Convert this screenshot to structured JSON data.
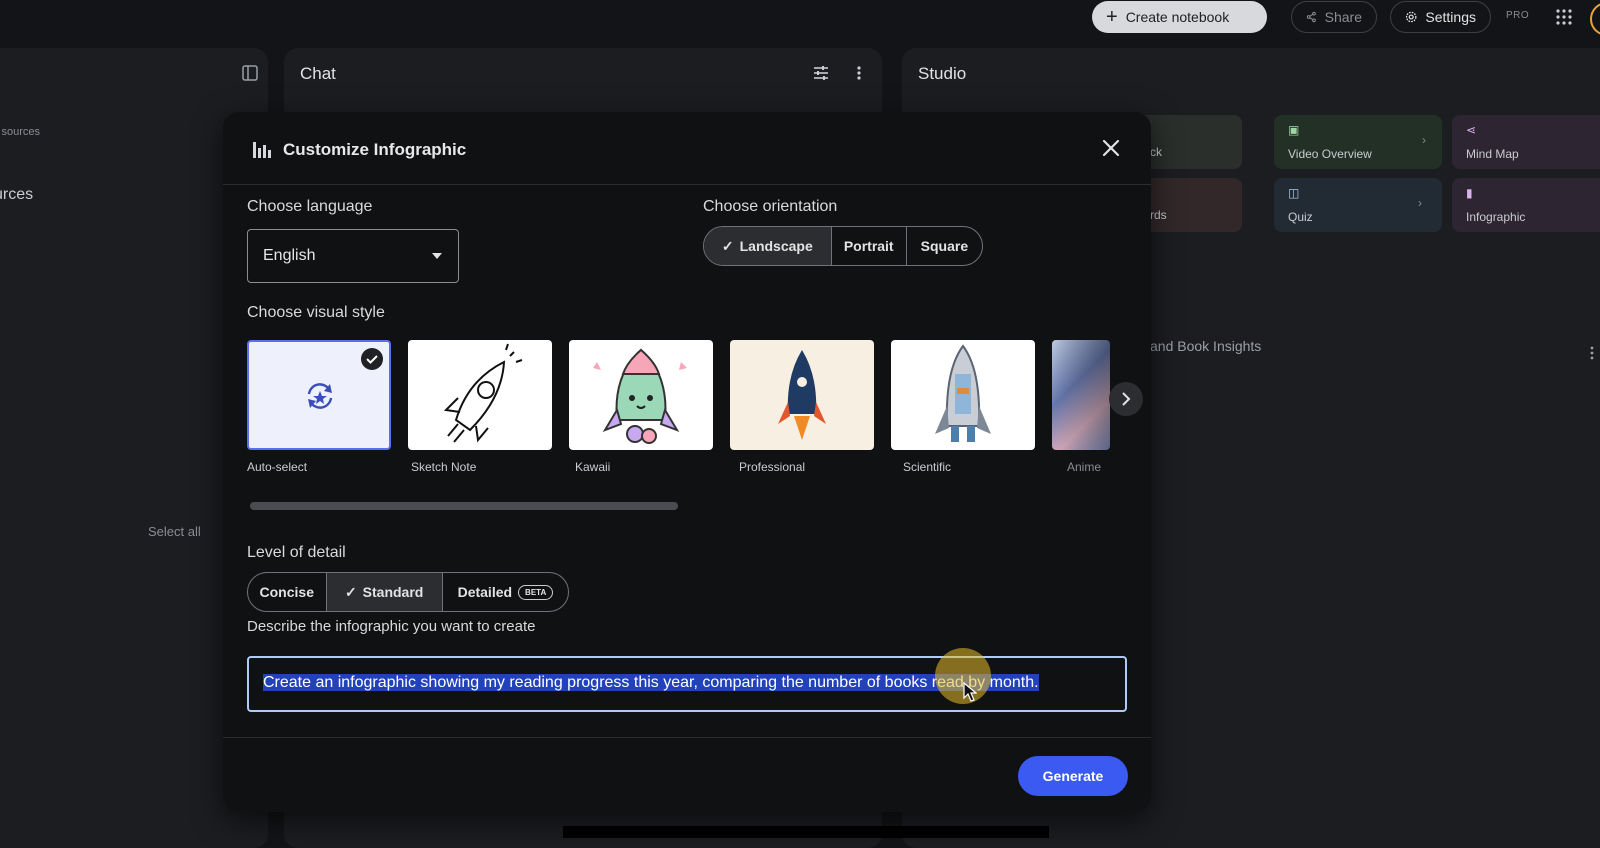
{
  "topbar": {
    "create_notebook": "Create notebook",
    "share": "Share",
    "settings": "Settings",
    "pro": "PRO"
  },
  "left_panel": {
    "sources_hint": "l sources",
    "sources_heading": "urces",
    "select_all": "Select all"
  },
  "chat_panel": {
    "title": "Chat"
  },
  "studio_panel": {
    "title": "Studio",
    "tiles": [
      {
        "label": "ck",
        "color": "#2f3a33"
      },
      {
        "label": "Video Overview",
        "color": "#253428"
      },
      {
        "label": "Mind Map",
        "color": "#322737"
      },
      {
        "label": "rds",
        "color": "#3a2a29"
      },
      {
        "label": "Quiz",
        "color": "#23303a"
      },
      {
        "label": "Infographic",
        "color": "#322737"
      }
    ],
    "note_title": "and Book Insights"
  },
  "dialog": {
    "title": "Customize Infographic",
    "language_label": "Choose language",
    "language_value": "English",
    "orientation_label": "Choose orientation",
    "orientations": [
      {
        "label": "Landscape",
        "selected": true
      },
      {
        "label": "Portrait",
        "selected": false
      },
      {
        "label": "Square",
        "selected": false
      }
    ],
    "visual_style_label": "Choose visual style",
    "styles": [
      {
        "label": "Auto-select",
        "selected": true
      },
      {
        "label": "Sketch Note",
        "selected": false
      },
      {
        "label": "Kawaii",
        "selected": false
      },
      {
        "label": "Professional",
        "selected": false
      },
      {
        "label": "Scientific",
        "selected": false
      },
      {
        "label": "Anime",
        "selected": false
      }
    ],
    "detail_label": "Level of detail",
    "details": [
      {
        "label": "Concise",
        "selected": false
      },
      {
        "label": "Standard",
        "selected": true
      },
      {
        "label": "Detailed",
        "selected": false
      }
    ],
    "beta_badge": "BETA",
    "describe_label": "Describe the infographic you want to create",
    "describe_value": "Create an infographic showing my reading progress this year, comparing the number of books read by month.",
    "generate": "Generate"
  },
  "colors": {
    "accent": "#3b5af2",
    "selection": "#2142b8"
  }
}
